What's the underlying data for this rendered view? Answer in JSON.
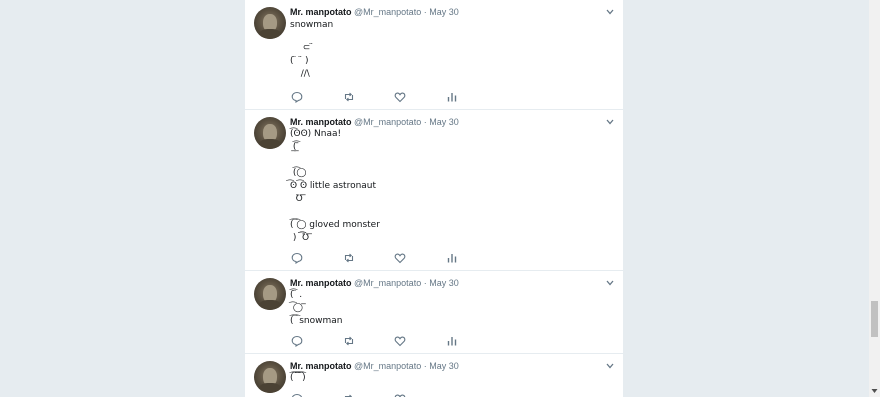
{
  "tweets": [
    {
      "name": "Mr. manpotato",
      "handle": "@Mr_manpotato",
      "separator": "·",
      "date": "May 30",
      "lines": [
        "snowman",
        "  ⊂ ̈",
        "( ̈  ̈ )",
        "  //\\"
      ]
    },
    {
      "name": "Mr. manpotato",
      "handle": "@Mr_manpotato",
      "separator": "·",
      "date": "May 30",
      "lines": [
        "(͡ʘʘ) Nnaa!",
        " (͡ ̄",
        "  ̅ ̅",
        " (͡◯",
        "͡ʘ ͡ʘ little astronaut",
        "  Ʊ ̅",
        "",
        "(͡ ͡◯ gloved monster",
        " )  ͡͡Ʊ ̅"
      ]
    },
    {
      "name": "Mr. manpotato",
      "handle": "@Mr_manpotato",
      "separator": "·",
      "date": "May 30",
      "lines": [
        "(͡ ̈ .",
        " ͡◯ ̅",
        "(͡ ͡ snowman"
      ]
    },
    {
      "name": "Mr. manpotato",
      "handle": "@Mr_manpotato",
      "separator": "·",
      "date": "May 30",
      "lines": [
        "(͡ ͡͡ ͡͡ ͡)"
      ]
    }
  ],
  "icons": {
    "reply": "reply-icon",
    "retweet": "retweet-icon",
    "like": "heart-icon",
    "analytics": "analytics-icon",
    "caret": "chevron-down-icon"
  },
  "colors": {
    "background": "#e6ecf0",
    "card": "#ffffff",
    "secondary_text": "#657786",
    "primary_text": "#14171a"
  }
}
